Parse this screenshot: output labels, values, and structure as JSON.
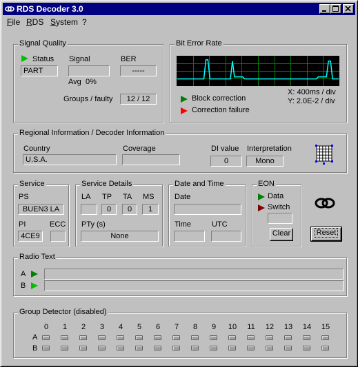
{
  "window": {
    "title": "RDS Decoder 3.0"
  },
  "menu": [
    "File",
    "RDS",
    "System",
    "?"
  ],
  "signal_quality": {
    "label": "Signal Quality",
    "status_label": "Status",
    "status_value": "PART",
    "signal_label": "Signal",
    "ber_label": "BER",
    "ber_value": "-----",
    "avg_label": "Avg",
    "avg_value": "0%",
    "groups_label": "Groups / faulty",
    "groups_value": "12 / 12"
  },
  "bit_error_rate": {
    "label": "Bit Error Rate",
    "block_correction": "Block correction",
    "correction_failure": "Correction failure",
    "x_scale": "X: 400ms / div",
    "y_scale": "Y: 2.0E-2 / div",
    "trace_color": "#00ffff",
    "grid_color": "#008000",
    "trace_levels": [
      0.22,
      0.22,
      0.22,
      0.22,
      0.22,
      0.22,
      0.22,
      0.22,
      0.22,
      0.22,
      0.22,
      0.22,
      0.22,
      0.22,
      0.95,
      0.95,
      0.22,
      0.22,
      0.22,
      0.22,
      0.22,
      0.22,
      0.22,
      0.22,
      0.22,
      0.22,
      0.22,
      0.9,
      0.3,
      0.3,
      0.3,
      0.3,
      0.3,
      0.22,
      0.22,
      0.22,
      0.22,
      0.22,
      0.22,
      0.22,
      0.22,
      0.22,
      0.22,
      0.22,
      0.22,
      0.22,
      0.22,
      0.22,
      0.22,
      0.22,
      0.22,
      0.22,
      0.22,
      0.22,
      0.22,
      0.22,
      0.22,
      0.22,
      0.22,
      0.22,
      0.22,
      0.22,
      0.22,
      0.22,
      0.22,
      0.22,
      0.22,
      0.22,
      0.22,
      0.3,
      0.3,
      0.3,
      0.3,
      0.3,
      0.9,
      0.9,
      0.22,
      0.22,
      0.22,
      0.22
    ]
  },
  "regional": {
    "label": "Regional Information / Decoder Information",
    "country_label": "Country",
    "country_value": "U.S.A.",
    "coverage_label": "Coverage",
    "coverage_value": "",
    "di_label": "DI value",
    "di_value": "0",
    "interp_label": "Interpretation",
    "interp_value": "Mono"
  },
  "service": {
    "label": "Service",
    "ps_label": "PS",
    "ps_value": "BUEN3 LA",
    "pi_label": "PI",
    "pi_value": "4CE9",
    "ecc_label": "ECC",
    "ecc_value": ""
  },
  "service_details": {
    "label": "Service Details",
    "la_label": "LA",
    "la_value": "",
    "tp_label": "TP",
    "tp_value": "0",
    "ta_label": "TA",
    "ta_value": "0",
    "ms_label": "MS",
    "ms_value": "1",
    "pty_label": "PTy (s)",
    "pty_value": "None"
  },
  "date_time": {
    "label": "Date and Time",
    "date_label": "Date",
    "date_value": "",
    "time_label": "Time",
    "time_value": "",
    "utc_label": "UTC",
    "utc_value": ""
  },
  "eon": {
    "label": "EON",
    "data_label": "Data",
    "switch_label": "Switch",
    "clear_label": "Clear"
  },
  "reset_label": "Reset",
  "radio_text": {
    "label": "Radio Text",
    "a_label": "A",
    "a_value": "",
    "b_label": "B",
    "b_value": ""
  },
  "group_detector": {
    "label": "Group Detector (disabled)",
    "columns": [
      "0",
      "1",
      "2",
      "3",
      "4",
      "5",
      "6",
      "7",
      "8",
      "9",
      "10",
      "11",
      "12",
      "13",
      "14",
      "15"
    ],
    "rows": [
      "A",
      "B"
    ]
  }
}
